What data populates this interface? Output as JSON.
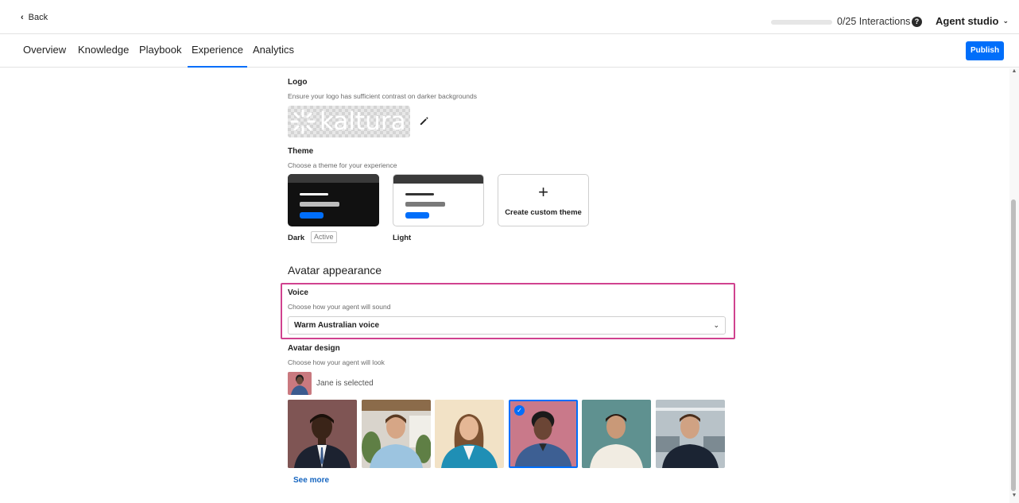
{
  "topbar": {
    "back_label": "Back",
    "interactions_label": "0/25 Interactions",
    "interactions_progress": 0,
    "studio_label": "Agent studio"
  },
  "tabs": [
    {
      "label": "Overview"
    },
    {
      "label": "Knowledge"
    },
    {
      "label": "Playbook"
    },
    {
      "label": "Experience",
      "active": true
    },
    {
      "label": "Analytics"
    }
  ],
  "publish_label": "Publish",
  "logo": {
    "title": "Logo",
    "description": "Ensure your logo has sufficient contrast on darker backgrounds",
    "brand_text": "kaltura"
  },
  "theme": {
    "title": "Theme",
    "description": "Choose a theme for your experience",
    "options": [
      {
        "name": "Dark",
        "badge": "Active"
      },
      {
        "name": "Light"
      }
    ],
    "custom_label": "Create custom theme"
  },
  "avatar_appearance": {
    "title": "Avatar appearance",
    "voice": {
      "title": "Voice",
      "description": "Choose how your agent will sound",
      "selected": "Warm Australian voice"
    },
    "design": {
      "title": "Avatar design",
      "description": "Choose how your agent will look",
      "selected_text": "Jane is selected",
      "see_more": "See more"
    }
  },
  "colors": {
    "accent": "#006efa",
    "highlight": "#d0428f"
  }
}
